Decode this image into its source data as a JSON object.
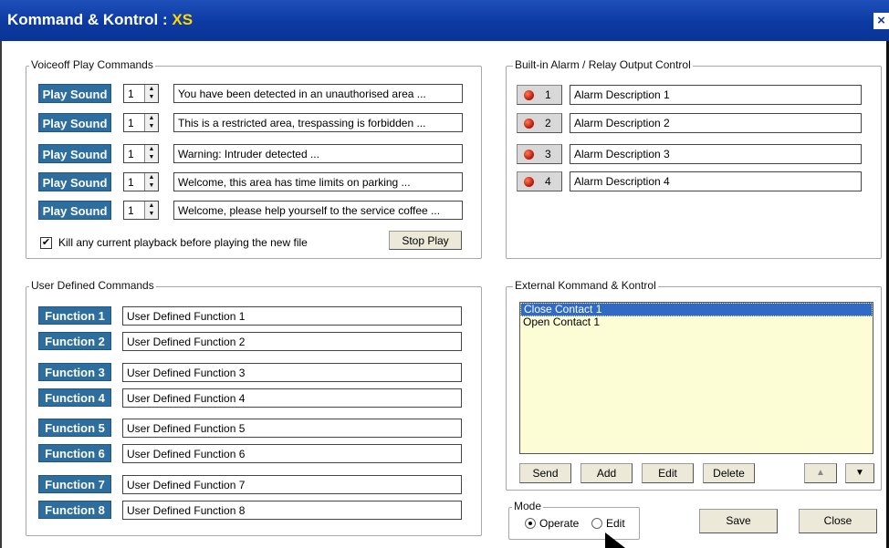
{
  "window": {
    "title_prefix": "Kommand & Kontrol : ",
    "title_suffix": "XS",
    "close_glyph": "×"
  },
  "voiceoff": {
    "label": "Voiceoff Play Commands",
    "play_label": "Play Sound",
    "rows": [
      {
        "count": "1",
        "text": "You have been detected in an unauthorised area ..."
      },
      {
        "count": "1",
        "text": "This is a restricted area, trespassing is forbidden ..."
      },
      {
        "count": "1",
        "text": "Warning: Intruder detected ..."
      },
      {
        "count": "1",
        "text": "Welcome, this area has time limits on parking ..."
      },
      {
        "count": "1",
        "text": "Welcome, please help yourself to the service coffee ..."
      }
    ],
    "kill_label": "Kill any current playback before playing the new file",
    "kill_checked": "✔",
    "stop_label": "Stop Play"
  },
  "alarm": {
    "label": "Built-in Alarm / Relay Output Control",
    "rows": [
      {
        "num": "1",
        "desc": "Alarm Description 1"
      },
      {
        "num": "2",
        "desc": "Alarm Description 2"
      },
      {
        "num": "3",
        "desc": "Alarm Description 3"
      },
      {
        "num": "4",
        "desc": "Alarm Description 4"
      }
    ]
  },
  "user": {
    "label": "User Defined Commands",
    "rows": [
      {
        "btn": "Function 1",
        "text": "User Defined Function 1"
      },
      {
        "btn": "Function 2",
        "text": "User Defined Function 2"
      },
      {
        "btn": "Function 3",
        "text": "User Defined Function 3"
      },
      {
        "btn": "Function 4",
        "text": "User Defined Function 4"
      },
      {
        "btn": "Function 5",
        "text": "User Defined Function 5"
      },
      {
        "btn": "Function 6",
        "text": "User Defined Function 6"
      },
      {
        "btn": "Function 7",
        "text": "User Defined Function 7"
      },
      {
        "btn": "Function 8",
        "text": "User Defined Function 8"
      }
    ]
  },
  "external": {
    "label": "External Kommand & Kontrol",
    "items": [
      "Close Contact 1",
      "Open Contact 1"
    ],
    "buttons": {
      "send": "Send",
      "add": "Add",
      "edit": "Edit",
      "delete": "Delete",
      "up": "▲",
      "down": "▼"
    }
  },
  "mode": {
    "label": "Mode",
    "operate": "Operate",
    "edit": "Edit"
  },
  "footer": {
    "save": "Save",
    "close": "Close"
  },
  "colors": {
    "titlebar": "#0c3aa3",
    "title_accent": "#ffd800",
    "button_blue": "#2d6e9e",
    "list_bg": "#fdfdd5",
    "selection": "#316ac5"
  }
}
